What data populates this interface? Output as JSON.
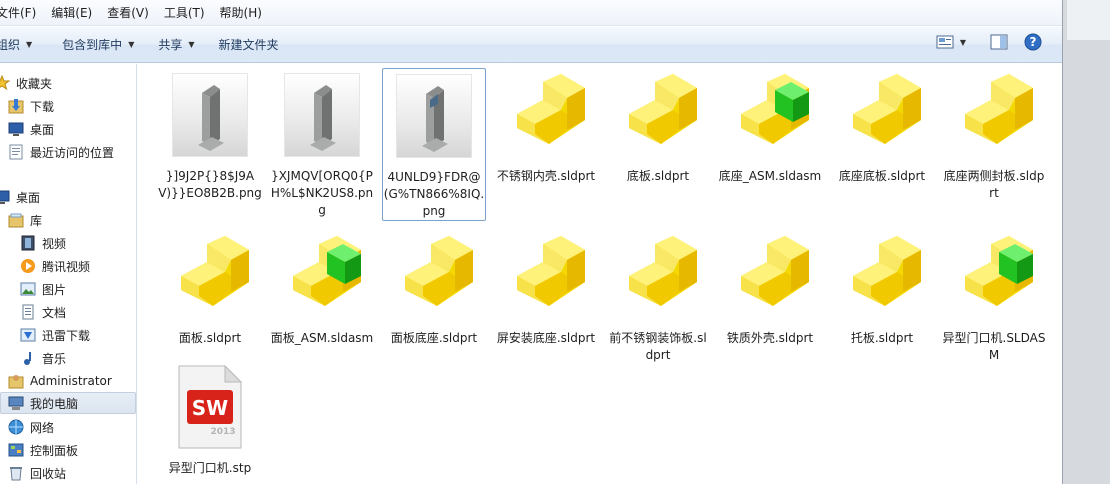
{
  "menubar": {
    "items": [
      {
        "label": "文件(F)"
      },
      {
        "label": "编辑(E)"
      },
      {
        "label": "查看(V)"
      },
      {
        "label": "工具(T)"
      },
      {
        "label": "帮助(H)"
      }
    ]
  },
  "commandbar": {
    "organize": "组织",
    "include_library": "包含到库中",
    "share": "共享",
    "new_folder": "新建文件夹"
  },
  "nav": {
    "favorites": "收藏夹",
    "downloads": "下载",
    "desktop": "桌面",
    "recent": "最近访问的位置",
    "desktop2": "桌面",
    "libraries": "库",
    "videos": "视频",
    "tencent_video": "腾讯视频",
    "pictures": "图片",
    "documents": "文档",
    "xunlei": "迅雷下载",
    "music": "音乐",
    "administrator": "Administrator",
    "computer": "我的电脑",
    "network": "网络",
    "control_panel": "控制面板",
    "recycle_bin": "回收站"
  },
  "files": [
    {
      "name": "}]9J2P{}8$J9AV)}}EO8B2B.png",
      "type": "png"
    },
    {
      "name": "}XJMQV[ORQ0{PH%L$NK2US8.png",
      "type": "png"
    },
    {
      "name": "4UNLD9}FDR@(G%TN866%8IQ.png",
      "type": "png"
    },
    {
      "name": "不锈钢内壳.sldprt",
      "type": "part"
    },
    {
      "name": "底板.sldprt",
      "type": "part"
    },
    {
      "name": "底座_ASM.sldasm",
      "type": "asm"
    },
    {
      "name": "底座底板.sldprt",
      "type": "part"
    },
    {
      "name": "底座两侧封板.sldprt",
      "type": "part"
    },
    {
      "name": "面板.sldprt",
      "type": "part"
    },
    {
      "name": "面板_ASM.sldasm",
      "type": "asm"
    },
    {
      "name": "面板底座.sldprt",
      "type": "part"
    },
    {
      "name": "屏安装底座.sldprt",
      "type": "part"
    },
    {
      "name": "前不锈钢装饰板.sldprt",
      "type": "part"
    },
    {
      "name": "铁质外壳.sldprt",
      "type": "part"
    },
    {
      "name": "托板.sldprt",
      "type": "part"
    },
    {
      "name": "异型门口机.SLDASM",
      "type": "asm"
    },
    {
      "name": "异型门口机.stp",
      "type": "stp"
    }
  ],
  "stp_icon": {
    "badge": "SW",
    "year": "2013"
  },
  "colors": {
    "part_yellow": "#f4d900",
    "asm_green": "#22c222",
    "accent_blue": "#1e5aa8"
  }
}
